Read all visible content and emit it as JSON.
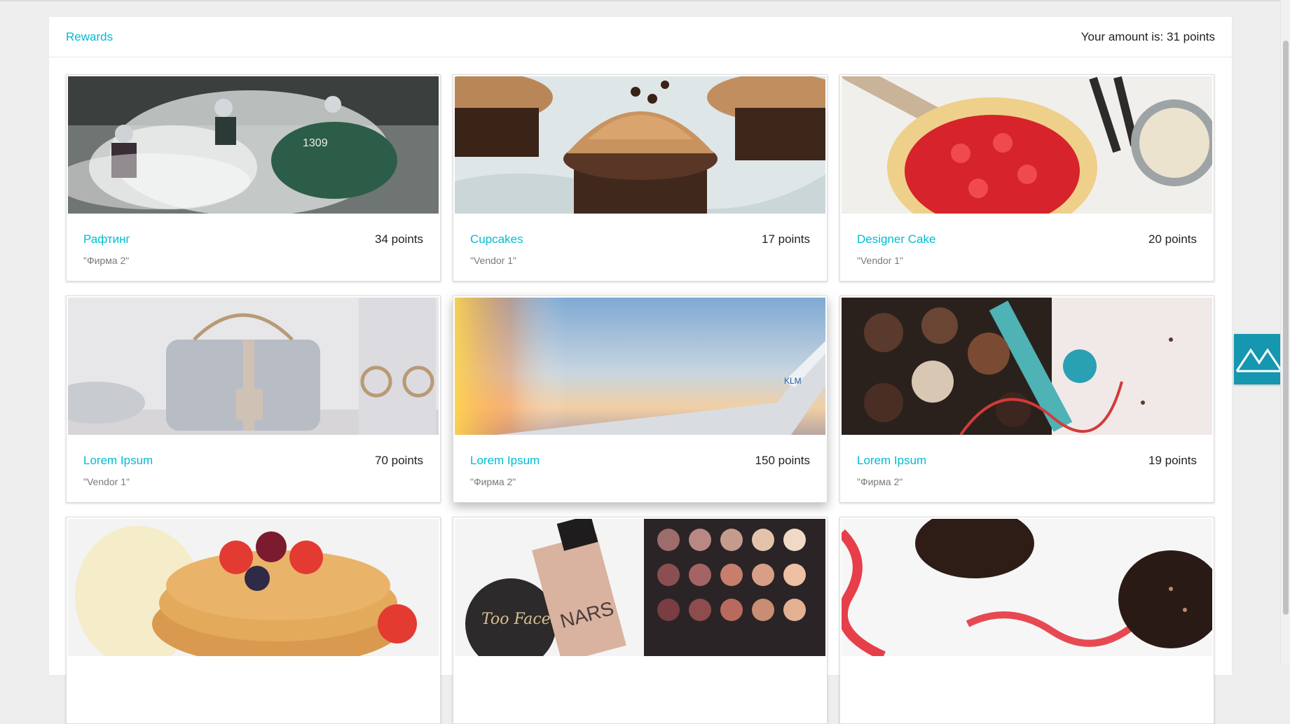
{
  "header": {
    "title": "Rewards",
    "amount": "Your amount is: 31 points"
  },
  "rewards": [
    {
      "title": "Рафтинг",
      "points": "34 points",
      "vendor": "\"Фирма 2\"",
      "image": "rafting-photo"
    },
    {
      "title": "Cupcakes",
      "points": "17 points",
      "vendor": "\"Vendor 1\"",
      "image": "cupcakes-photo"
    },
    {
      "title": "Designer Cake",
      "points": "20 points",
      "vendor": "\"Vendor 1\"",
      "image": "strawberry-galette-photo"
    },
    {
      "title": "Lorem Ipsum",
      "points": "70 points",
      "vendor": "\"Vendor 1\"",
      "image": "handbag-photo"
    },
    {
      "title": "Lorem Ipsum",
      "points": "150 points",
      "vendor": "\"Фирма 2\"",
      "image": "airplane-wing-photo"
    },
    {
      "title": "Lorem Ipsum",
      "points": "19 points",
      "vendor": "\"Фирма 2\"",
      "image": "chocolates-photo"
    },
    {
      "title": "",
      "points": "",
      "vendor": "",
      "image": "pancakes-photo"
    },
    {
      "title": "",
      "points": "",
      "vendor": "",
      "image": "makeup-palette-photo"
    },
    {
      "title": "",
      "points": "",
      "vendor": "",
      "image": "chocolate-hearts-photo"
    }
  ],
  "colors": {
    "accent": "#00bcd4",
    "feedback_tab": "#1597b0"
  },
  "icons": {
    "feedback_tab": "mountain-logo-icon"
  }
}
